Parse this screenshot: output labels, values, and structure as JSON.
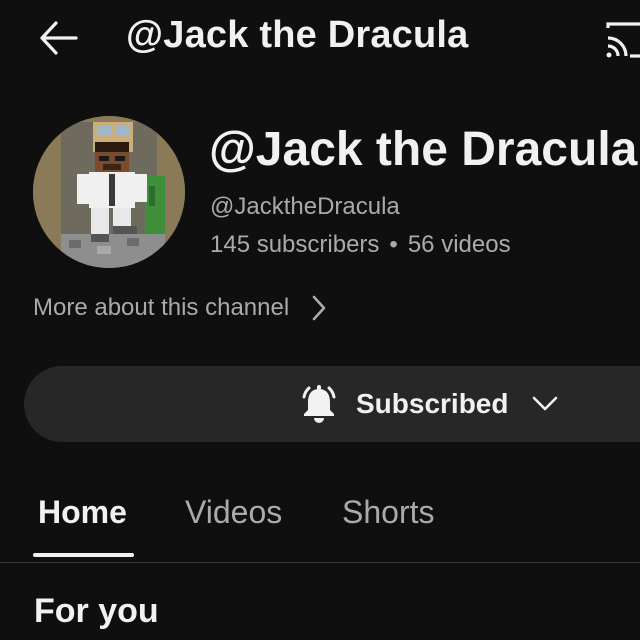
{
  "header": {
    "title": "@Jack the Dracula",
    "back_icon": "arrow-left-icon",
    "cast_icon": "cast-icon"
  },
  "channel": {
    "name": "@Jack the Dracula",
    "handle": "@JacktheDracula",
    "subscribers": "145 subscribers",
    "separator": "•",
    "videos": "56 videos",
    "more_about": "More about this channel",
    "avatar_icon": "minecraft-character-avatar"
  },
  "subscribe": {
    "label": "Subscribed",
    "bell_icon": "bell-icon",
    "chevron_icon": "chevron-down-icon"
  },
  "tabs": [
    {
      "label": "Home",
      "active": true
    },
    {
      "label": "Videos",
      "active": false
    },
    {
      "label": "Shorts",
      "active": false
    }
  ],
  "section": {
    "title": "For you"
  },
  "colors": {
    "background": "#0f0f0f",
    "text_primary": "#f1f1f1",
    "text_secondary": "#aaaaaa",
    "button_bg": "#272727"
  }
}
